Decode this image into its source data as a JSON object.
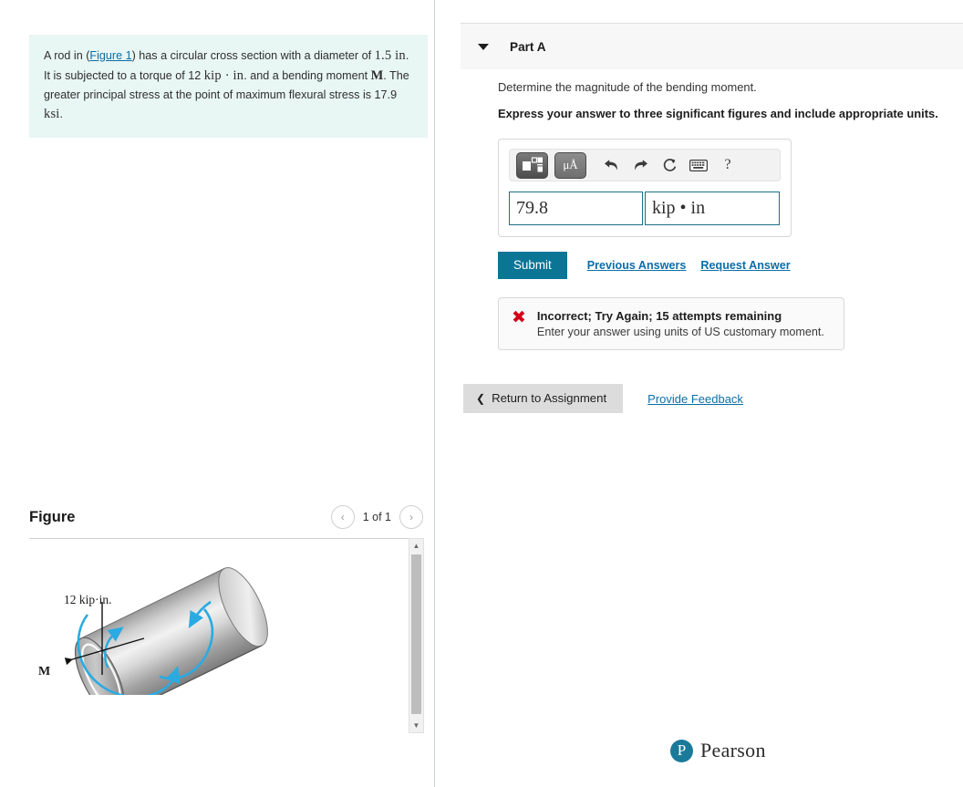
{
  "problem": {
    "line1_a": "A rod in (",
    "figure_link": "Figure 1",
    "line1_b": ") has a circular cross section with a diameter of",
    "diameter": "1.5 in",
    "line2_b": ". It is subjected to a torque of 12 ",
    "torque_units": "kip · in",
    "line2_c": ". and a bending",
    "line3_a": "moment ",
    "moment_symbol": "M",
    "line3_b": ". The greater principal stress at the point of maximum",
    "line4_a": "flexural stress is 17.9 ",
    "stress_units": "ksi",
    "line4_b": "."
  },
  "figure": {
    "title": "Figure",
    "pager_label": "1 of 1",
    "prev_icon": "‹",
    "next_icon": "›",
    "torque_label": "12 kip·in.",
    "moment_label": "M",
    "scroll_up_icon": "▲",
    "scroll_down_icon": "▼"
  },
  "part": {
    "title": "Part A",
    "caret_icon": "caret-down",
    "question": "Determine the magnitude of the bending moment.",
    "instruction": "Express your answer to three significant figures and include appropriate units."
  },
  "toolbar": {
    "template_icon": "math-template-icon",
    "units_label": "μÅ",
    "undo_icon": "undo-arrow",
    "redo_icon": "redo-arrow",
    "reset_icon": "reset-circular-arrow",
    "keyboard_icon": "keyboard",
    "help_label": "?"
  },
  "answer": {
    "value": "79.8",
    "unit": "kip • in",
    "value_placeholder": "",
    "unit_placeholder": ""
  },
  "actions": {
    "submit_label": "Submit",
    "previous_answers_label": "Previous Answers",
    "request_answer_label": "Request Answer",
    "return_label": "Return to Assignment",
    "return_caret": "❮",
    "provide_feedback_label": "Provide Feedback"
  },
  "feedback": {
    "icon": "✖",
    "title": "Incorrect; Try Again; 15 attempts remaining",
    "detail": "Enter your answer using units of US customary moment."
  },
  "footer": {
    "logo_letter": "P",
    "logo_text": "Pearson"
  },
  "colors": {
    "accent_teal": "#0b7596",
    "link_blue": "#0b6ea8",
    "error_red": "#d0021b",
    "problem_bg": "#e8f6f4",
    "figure_arrow_cyan": "#29abe2"
  }
}
